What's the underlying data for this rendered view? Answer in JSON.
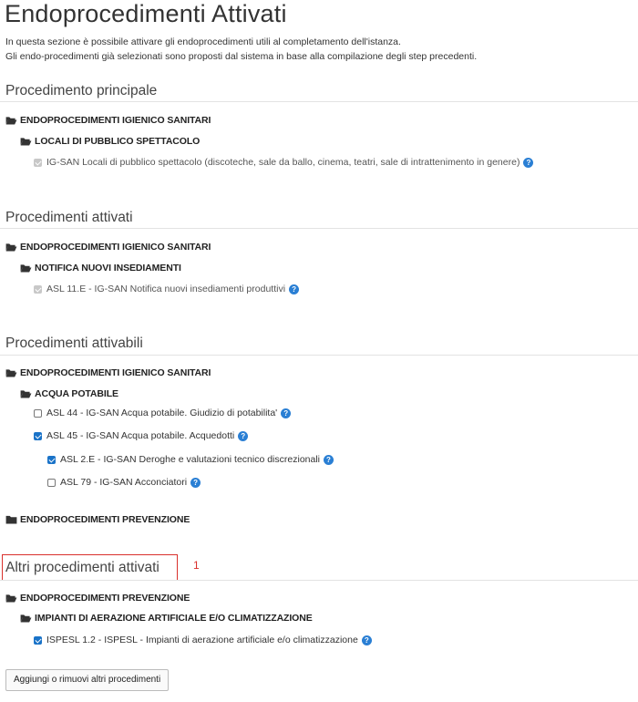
{
  "page": {
    "title": "Endoprocedimenti Attivati",
    "intro_line1": "In questa sezione è possibile attivare gli endoprocedimenti utili al completamento dell'istanza.",
    "intro_line2": "Gli endo-procedimenti già selezionati sono proposti dal sistema in base alla compilazione degli step precedenti."
  },
  "sections": {
    "principale": {
      "title": "Procedimento principale",
      "group": "ENDOPROCEDIMENTI IGIENICO SANITARI",
      "subgroup": "LOCALI DI PUBBLICO SPETTACOLO",
      "item": "IG-SAN Locali di pubblico spettacolo (discoteche, sale da ballo, cinema, teatri, sale di intrattenimento in genere)"
    },
    "attivati": {
      "title": "Procedimenti attivati",
      "group": "ENDOPROCEDIMENTI IGIENICO SANITARI",
      "subgroup": "NOTIFICA NUOVI INSEDIAMENTI",
      "item": "ASL 11.E - IG-SAN Notifica nuovi insediamenti produttivi"
    },
    "attivabili": {
      "title": "Procedimenti attivabili",
      "group": "ENDOPROCEDIMENTI IGIENICO SANITARI",
      "subgroup": "ACQUA POTABILE",
      "item1": "ASL 44 - IG-SAN Acqua potabile. Giudizio di potabilita'",
      "item2": "ASL 45 - IG-SAN Acqua potabile. Acquedotti",
      "item3": "ASL 2.E - IG-SAN Deroghe e valutazioni tecnico discrezionali",
      "item4": "ASL 79 - IG-SAN Acconciatori",
      "group2": "ENDOPROCEDIMENTI PREVENZIONE"
    },
    "altri": {
      "title": "Altri procedimenti attivati",
      "group": "ENDOPROCEDIMENTI PREVENZIONE",
      "subgroup": "IMPIANTI DI AERAZIONE ARTIFICIALE E/O CLIMATIZZAZIONE",
      "item": "ISPESL 1.2 - ISPESL - Impianti di aerazione artificiale e/o climatizzazione"
    }
  },
  "annotation": {
    "number": "1",
    "color": "#d9302c"
  },
  "buttons": {
    "manage_label": "Aggiungi o rimuovi altri procedimenti"
  },
  "colors": {
    "accent": "#1a73c8",
    "help": "#2a7fd4"
  },
  "icons": {
    "folder_open": "folder-open-icon",
    "folder_closed": "folder-closed-icon",
    "help": "question-circle-icon"
  }
}
